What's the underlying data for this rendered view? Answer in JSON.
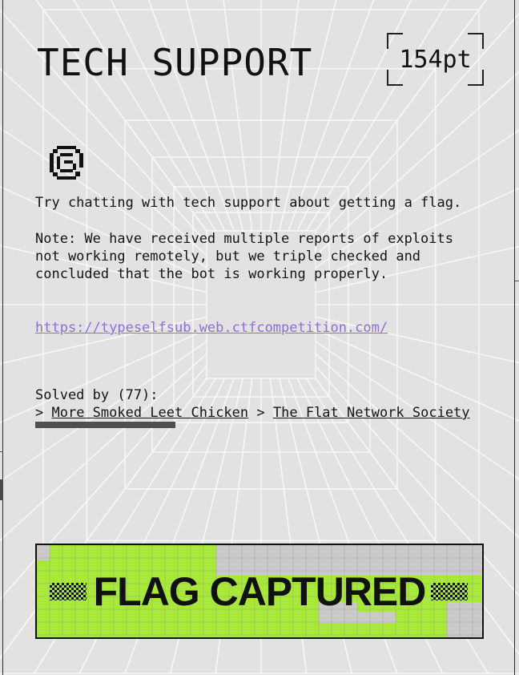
{
  "challenge": {
    "title": "TECH SUPPORT",
    "points": "154pt",
    "icon": "spiral-icon",
    "description": "Try chatting with tech support about getting a flag.",
    "note_lines": [
      "Note: We have received multiple reports of exploits",
      "not working remotely, but we triple checked and",
      "concluded that the bot is working properly."
    ],
    "link": "https://typeselfsub.web.ctfcompetition.com/",
    "solved_by": "Solved by (77):",
    "solver_prefix": ">",
    "solvers": [
      "More Smoked Leet Chicken",
      "The Flat Network Society"
    ],
    "flag_status": "FLAG CAPTURED"
  },
  "colors": {
    "background": "#e2e2e2",
    "link": "#8e6fd9",
    "flag_green": "#a8e83a",
    "flag_gray": "#c9c9c9",
    "text": "#141414"
  }
}
